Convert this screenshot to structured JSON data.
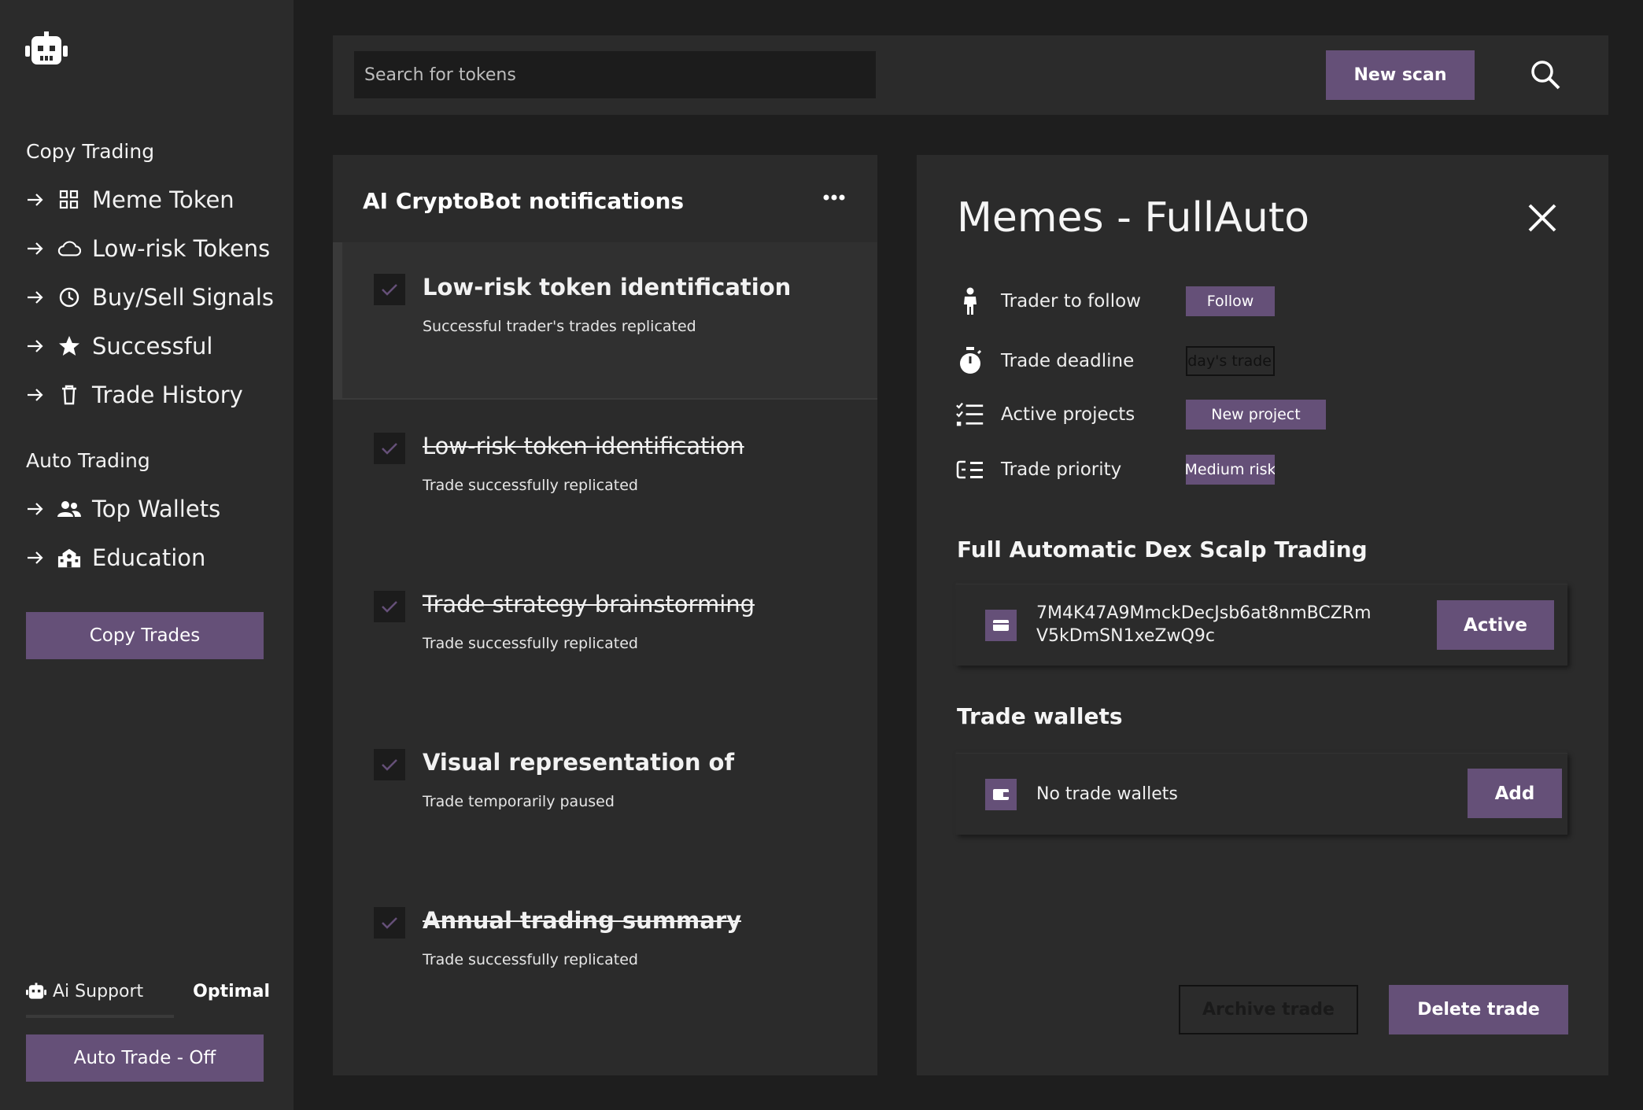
{
  "sidebar": {
    "copy_trading_title": "Copy Trading",
    "copy_items": [
      {
        "label": "Meme Token",
        "icon": "grid-icon"
      },
      {
        "label": "Low-risk Tokens",
        "icon": "cloud-icon"
      },
      {
        "label": "Buy/Sell Signals",
        "icon": "clock-icon"
      },
      {
        "label": "Successful",
        "icon": "star-icon"
      },
      {
        "label": "Trade History",
        "icon": "trash-icon"
      }
    ],
    "auto_trading_title": "Auto Trading",
    "auto_items": [
      {
        "label": "Top Wallets",
        "icon": "people-icon"
      },
      {
        "label": "Education",
        "icon": "school-icon"
      }
    ],
    "copy_trades_button": "Copy Trades",
    "ai_support_label": "Ai Support",
    "ai_support_value": "Optimal",
    "auto_trade_button": "Auto Trade - Off"
  },
  "topbar": {
    "search_placeholder": "Search for tokens",
    "new_scan_button": "New scan"
  },
  "notifications": {
    "header": "AI CryptoBot notifications",
    "items": [
      {
        "title": "Low-risk token identification",
        "subtitle": "Successful trader's trades replicated",
        "checked": true,
        "selected": true
      },
      {
        "title": "Low-risk token identification",
        "subtitle": "Trade successfully replicated",
        "checked": true
      },
      {
        "title": "Trade strategy brainstorming",
        "subtitle": "Trade successfully replicated",
        "checked": true
      },
      {
        "title": "Visual representation of",
        "subtitle": "Trade temporarily paused",
        "checked": true
      },
      {
        "title": "Annual trading summary",
        "subtitle": "Trade successfully replicated",
        "checked": true
      }
    ]
  },
  "detail": {
    "title": "Memes - FullAuto",
    "props": [
      {
        "label": "Trader to follow",
        "tag": "Follow",
        "icon": "person-icon"
      },
      {
        "label": "Trade deadline",
        "tag": "Today's trade",
        "icon": "stopwatch-icon"
      },
      {
        "label": "Active projects",
        "tag": "New project",
        "icon": "checklist-icon"
      },
      {
        "label": "Trade priority",
        "tag": "Medium risk",
        "icon": "priority-icon"
      }
    ],
    "scalp_title": "Full Automatic Dex Scalp Trading",
    "scalp_wallet_line1": "7M4K47A9MmckDecJsb6at8nmBCZRm",
    "scalp_wallet_line2": "V5kDmSN1xeZwQ9c",
    "scalp_button": "Active",
    "trade_wallets_title": "Trade wallets",
    "no_wallets_text": "No trade wallets",
    "add_button": "Add",
    "archive_button": "Archive trade",
    "delete_button": "Delete trade"
  },
  "colors": {
    "accent": "#655078",
    "background": "#1e1e1e",
    "panel": "#2b2b2b"
  }
}
